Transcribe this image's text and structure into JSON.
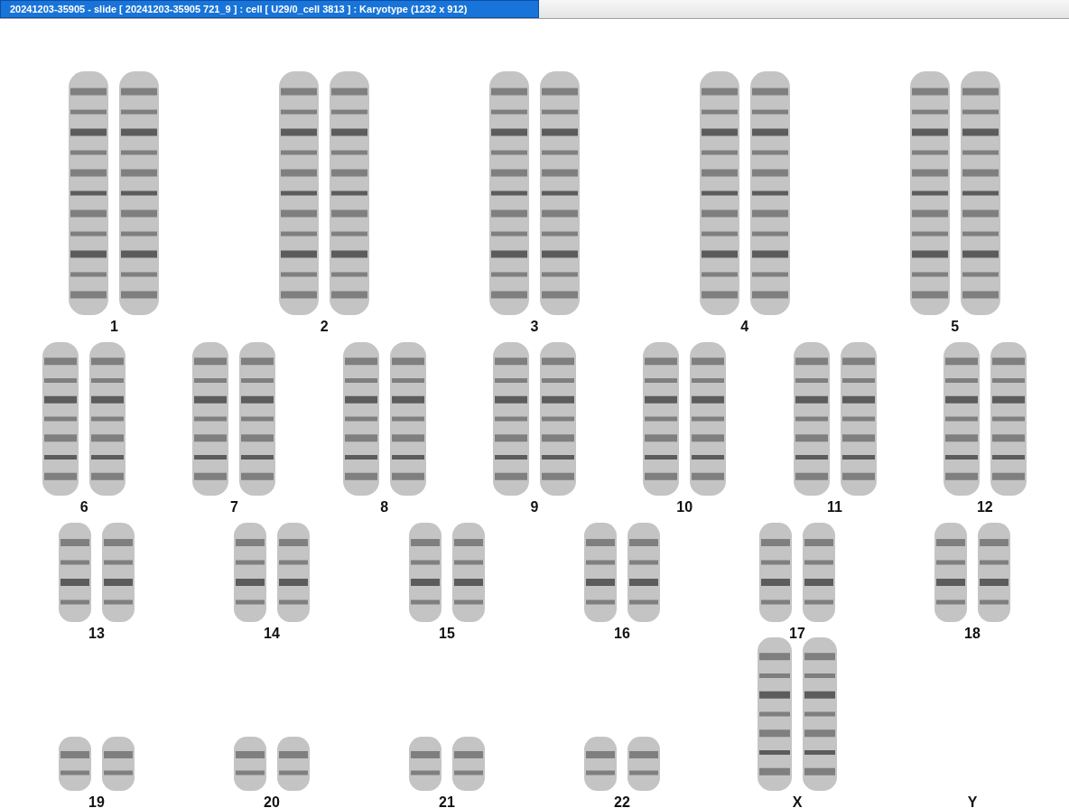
{
  "window": {
    "title": "20241203-35905 - slide [ 20241203-35905 721_9 ] : cell [ U29/0_cell 3813 ] : Karyotype  (1232 x 912)"
  },
  "karyotype": {
    "rows": [
      {
        "chromosomes": [
          {
            "label": "1",
            "kind": "large"
          },
          {
            "label": "2",
            "kind": "large"
          },
          {
            "label": "3",
            "kind": "large"
          },
          {
            "label": "4",
            "kind": "large"
          },
          {
            "label": "5",
            "kind": "large"
          }
        ]
      },
      {
        "chromosomes": [
          {
            "label": "6",
            "kind": "medium"
          },
          {
            "label": "7",
            "kind": "medium"
          },
          {
            "label": "8",
            "kind": "medium"
          },
          {
            "label": "9",
            "kind": "medium"
          },
          {
            "label": "10",
            "kind": "medium"
          },
          {
            "label": "11",
            "kind": "medium"
          },
          {
            "label": "12",
            "kind": "medium"
          }
        ]
      },
      {
        "chromosomes": [
          {
            "label": "13",
            "kind": "small"
          },
          {
            "label": "14",
            "kind": "small"
          },
          {
            "label": "15",
            "kind": "small"
          },
          {
            "label": "16",
            "kind": "small"
          },
          {
            "label": "17",
            "kind": "small"
          },
          {
            "label": "18",
            "kind": "small"
          }
        ]
      },
      {
        "chromosomes": [
          {
            "label": "19",
            "kind": "tiny"
          },
          {
            "label": "20",
            "kind": "tiny"
          },
          {
            "label": "21",
            "kind": "tiny"
          },
          {
            "label": "22",
            "kind": "tiny"
          },
          {
            "label": "X",
            "kind": "sex"
          },
          {
            "label": "Y",
            "kind": "empty"
          }
        ]
      }
    ]
  }
}
